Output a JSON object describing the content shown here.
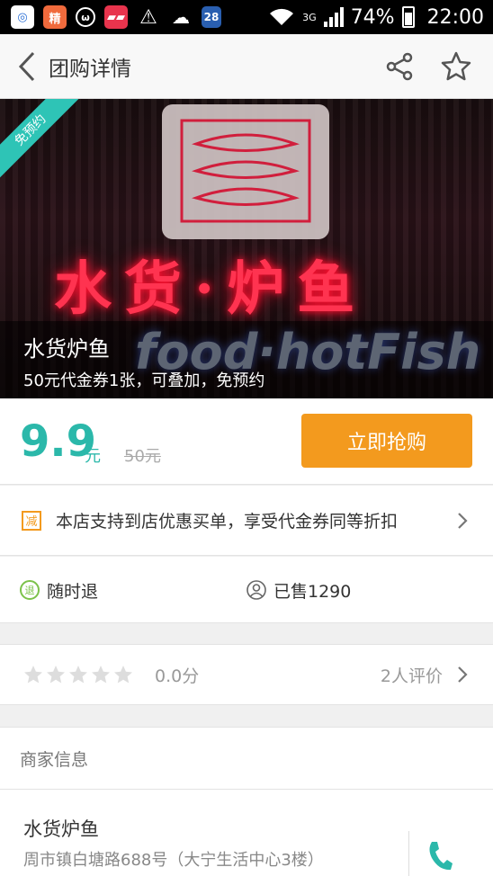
{
  "status_bar": {
    "net": "3G",
    "battery": "74%",
    "time": "22:00",
    "notif_badge": "28"
  },
  "nav": {
    "title": "团购详情"
  },
  "hero": {
    "ribbon": "免预约",
    "title": "水货炉鱼",
    "subtitle": "50元代金券1张，可叠加，免预约"
  },
  "price": {
    "current": "9.9",
    "unit": "元",
    "original": "50元",
    "buy_label": "立即抢购"
  },
  "promo": {
    "icon_text": "减",
    "text": "本店支持到店优惠买单，享受代金券同等折扣"
  },
  "guarantees": {
    "refund_icon_text": "退",
    "refund": "随时退",
    "sold": "已售1290"
  },
  "rating": {
    "stars": 0,
    "score": "0.0分",
    "reviews": "2人评价"
  },
  "merchant": {
    "section_title": "商家信息",
    "name": "水货炉鱼",
    "address": "周市镇白塘路688号（大宁生活中心3楼）"
  },
  "colors": {
    "accent": "#2bb8aa",
    "buy": "#f39a1e",
    "refund": "#7cc24a"
  }
}
